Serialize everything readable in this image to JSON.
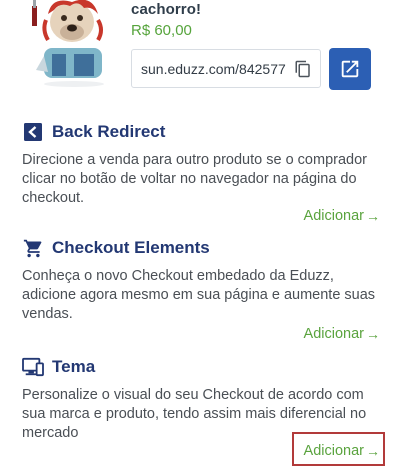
{
  "product": {
    "name": "cachorro!",
    "price": "R$ 60,00",
    "link": "sun.eduzz.com/842577"
  },
  "icons": {
    "copy": "copy-icon",
    "open": "open-external-icon",
    "back": "back-arrow-box-icon",
    "cart": "shopping-cart-icon",
    "theme": "monitor-phone-icon"
  },
  "colors": {
    "accent_blue": "#2c5fb4",
    "title_blue": "#233873",
    "green": "#5aa33e",
    "highlight_red": "#b23a3a"
  },
  "sections": [
    {
      "title": "Back Redirect",
      "description": "Direcione a venda para outro produto se o comprador clicar no botão de voltar no navegador na página do checkout.",
      "action": "Adicionar"
    },
    {
      "title": "Checkout Elements",
      "description": "Conheça o novo Checkout embedado da Eduzz, adicione agora mesmo em sua página e aumente suas vendas.",
      "action": "Adicionar"
    },
    {
      "title": "Tema",
      "description": "Personalize o visual do seu Checkout de acordo com sua marca e produto, tendo assim mais diferencial no mercado",
      "action": "Adicionar"
    }
  ]
}
